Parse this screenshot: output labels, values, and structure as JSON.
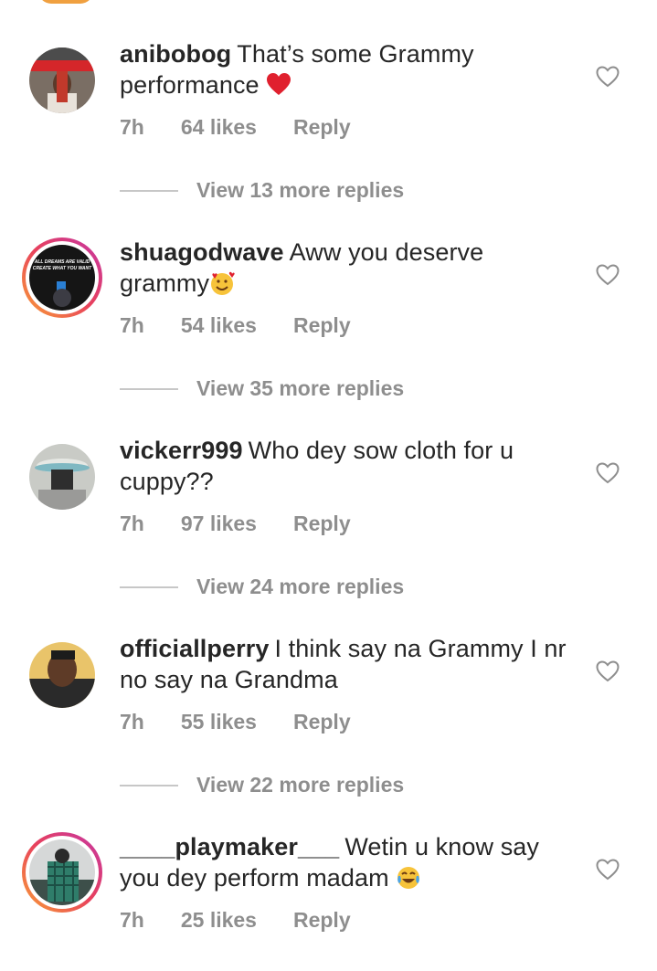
{
  "comments": [
    {
      "username": "anibobog",
      "text": "That’s some Grammy performance",
      "time": "7h",
      "likes": "64 likes",
      "reply": "Reply",
      "view_replies": "View 13 more replies"
    },
    {
      "username": "shuagodwave",
      "text": "Aww you deserve grammy",
      "time": "7h",
      "likes": "54 likes",
      "reply": "Reply",
      "view_replies": "View 35 more replies",
      "avatar_text": [
        "ALL DREAMS ARE VALID",
        "CREATE WHAT YOU WANT"
      ]
    },
    {
      "username": "vickerr999",
      "text": "Who dey sow cloth for u cuppy??",
      "time": "7h",
      "likes": "97 likes",
      "reply": "Reply",
      "view_replies": "View 24 more replies"
    },
    {
      "username": "officiallperry",
      "text": "I think say na Grammy I nr no say na Grandma",
      "time": "7h",
      "likes": "55 likes",
      "reply": "Reply",
      "view_replies": "View 22 more replies"
    },
    {
      "username": "____playmaker___",
      "text": "Wetin u know say you dey perform madam",
      "time": "7h",
      "likes": "25 likes",
      "reply": "Reply"
    }
  ],
  "icons": {
    "like": "heart-outline-icon",
    "emoji_1": "red-heart-emoji",
    "emoji_2": "smiling-face-with-hearts-emoji",
    "emoji_3": "tears-of-joy-emoji"
  },
  "colors": {
    "text": "#262626",
    "muted": "#8e8e8e",
    "story_ring": "#e8415c"
  }
}
